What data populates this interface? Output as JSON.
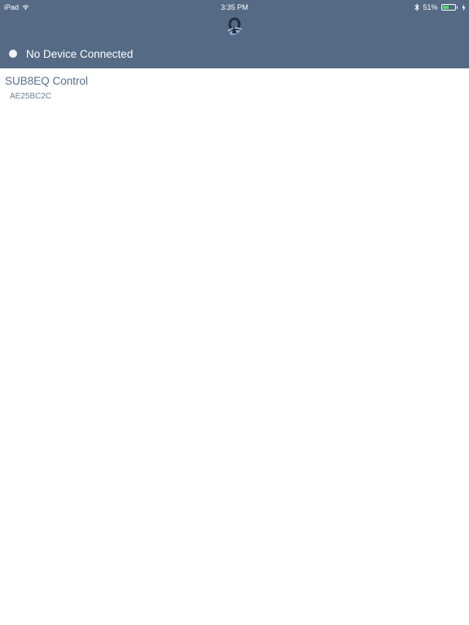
{
  "status_bar": {
    "device": "iPad",
    "time": "3:35 PM",
    "battery_percent": "51%",
    "battery_level": 0.51,
    "battery_fill_color": "#4cd964",
    "icons": [
      "wifi-icon",
      "bluetooth-icon",
      "battery-icon",
      "charging-bolt-icon"
    ]
  },
  "header": {
    "background_color": "#546a85",
    "logo_icon": "brand-logo-icon",
    "connection_status": "No Device Connected",
    "status_indicator_color": "#eef1f5"
  },
  "devices": [
    {
      "name": "SUB8EQ Control",
      "id": "AE25BC2C"
    }
  ]
}
